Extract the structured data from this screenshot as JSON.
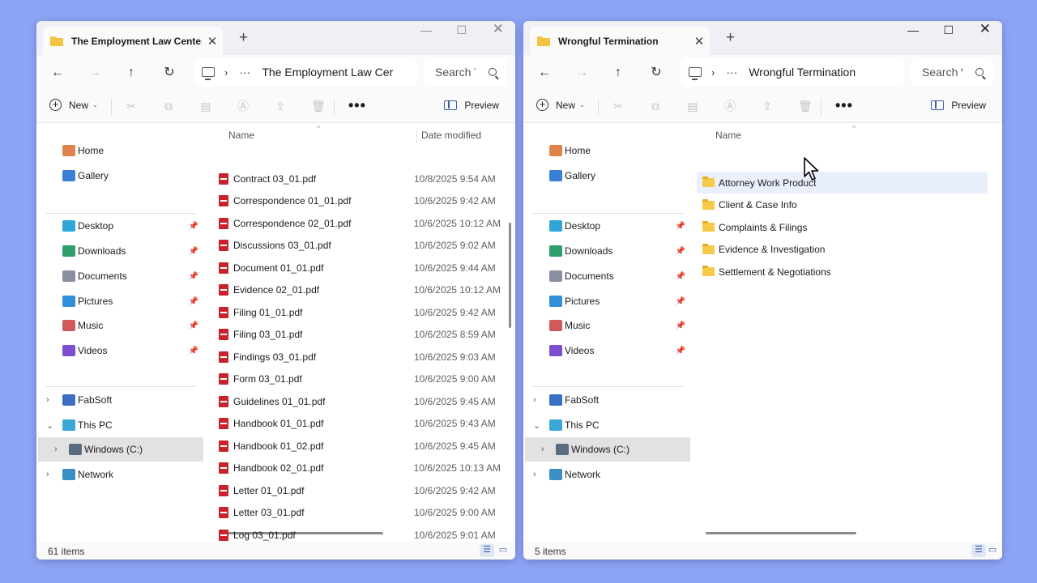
{
  "left": {
    "tab_title": "The Employment Law Center",
    "address": "The Employment Law Cer",
    "search_placeholder": "Search T",
    "new_label": "New",
    "preview_label": "Preview",
    "sidebar": [
      {
        "label": "Home",
        "icon": "home-icon"
      },
      {
        "label": "Gallery",
        "icon": "gallery-icon"
      },
      {
        "label": "Desktop",
        "icon": "desktop-icon",
        "pinned": true
      },
      {
        "label": "Downloads",
        "icon": "downloads-icon",
        "pinned": true
      },
      {
        "label": "Documents",
        "icon": "documents-icon",
        "pinned": true
      },
      {
        "label": "Pictures",
        "icon": "pictures-icon",
        "pinned": true
      },
      {
        "label": "Music",
        "icon": "music-icon",
        "pinned": true
      },
      {
        "label": "Videos",
        "icon": "videos-icon",
        "pinned": true
      },
      {
        "label": "FabSoft",
        "icon": "fabsoft-icon"
      },
      {
        "label": "This PC",
        "icon": "pc-icon"
      },
      {
        "label": "Windows (C:)",
        "icon": "drive-icon",
        "selected": true
      },
      {
        "label": "Network",
        "icon": "network-icon"
      }
    ],
    "columns": {
      "name": "Name",
      "date": "Date modified"
    },
    "files": [
      {
        "name": "Contract 03_01.pdf",
        "date": "10/8/2025 9:54 AM"
      },
      {
        "name": "Correspondence 01_01.pdf",
        "date": "10/6/2025 9:42 AM"
      },
      {
        "name": "Correspondence 02_01.pdf",
        "date": "10/6/2025 10:12 AM"
      },
      {
        "name": "Discussions 03_01.pdf",
        "date": "10/6/2025 9:02 AM"
      },
      {
        "name": "Document 01_01.pdf",
        "date": "10/6/2025 9:44 AM"
      },
      {
        "name": "Evidence 02_01.pdf",
        "date": "10/6/2025 10:12 AM"
      },
      {
        "name": "Filing 01_01.pdf",
        "date": "10/6/2025 9:42 AM"
      },
      {
        "name": "Filing 03_01.pdf",
        "date": "10/6/2025 8:59 AM"
      },
      {
        "name": "Findings 03_01.pdf",
        "date": "10/6/2025 9:03 AM"
      },
      {
        "name": "Form 03_01.pdf",
        "date": "10/6/2025 9:00 AM"
      },
      {
        "name": "Guidelines 01_01.pdf",
        "date": "10/6/2025 9:45 AM"
      },
      {
        "name": "Handbook 01_01.pdf",
        "date": "10/6/2025 9:43 AM"
      },
      {
        "name": "Handbook 01_02.pdf",
        "date": "10/6/2025 9:45 AM"
      },
      {
        "name": "Handbook 02_01.pdf",
        "date": "10/6/2025 10:13 AM"
      },
      {
        "name": "Letter 01_01.pdf",
        "date": "10/6/2025 9:42 AM"
      },
      {
        "name": "Letter 03_01.pdf",
        "date": "10/6/2025 9:00 AM"
      },
      {
        "name": "Log 03_01.pdf",
        "date": "10/6/2025 9:01 AM"
      }
    ],
    "status": "61 items"
  },
  "right": {
    "tab_title": "Wrongful Termination",
    "address": "Wrongful Termination",
    "search_placeholder": "Search W",
    "new_label": "New",
    "preview_label": "Preview",
    "sidebar": [
      {
        "label": "Home",
        "icon": "home-icon"
      },
      {
        "label": "Gallery",
        "icon": "gallery-icon"
      },
      {
        "label": "Desktop",
        "icon": "desktop-icon",
        "pinned": true
      },
      {
        "label": "Downloads",
        "icon": "downloads-icon",
        "pinned": true
      },
      {
        "label": "Documents",
        "icon": "documents-icon",
        "pinned": true
      },
      {
        "label": "Pictures",
        "icon": "pictures-icon",
        "pinned": true
      },
      {
        "label": "Music",
        "icon": "music-icon",
        "pinned": true
      },
      {
        "label": "Videos",
        "icon": "videos-icon",
        "pinned": true
      },
      {
        "label": "FabSoft",
        "icon": "fabsoft-icon"
      },
      {
        "label": "This PC",
        "icon": "pc-icon"
      },
      {
        "label": "Windows (C:)",
        "icon": "drive-icon",
        "selected": true
      },
      {
        "label": "Network",
        "icon": "network-icon"
      }
    ],
    "columns": {
      "name": "Name"
    },
    "folders": [
      {
        "name": "Attorney Work Product",
        "hovered": true
      },
      {
        "name": "Client & Case Info"
      },
      {
        "name": "Complaints & Filings"
      },
      {
        "name": "Evidence & Investigation"
      },
      {
        "name": "Settlement & Negotiations"
      }
    ],
    "status": "5 items"
  },
  "colors": {
    "desktop_bg": "#8ea4f5",
    "pdf_red": "#c8232c",
    "folder_yellow": "#f7c948",
    "selection_gray": "#e2e2e2",
    "accent_blue": "#3a5ea8"
  }
}
